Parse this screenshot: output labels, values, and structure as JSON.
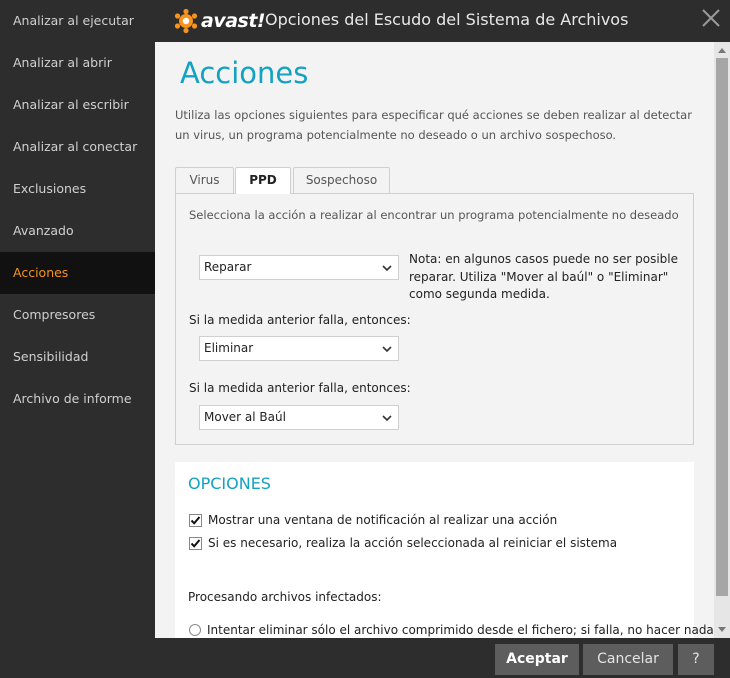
{
  "window": {
    "brand": "avast!",
    "title": "Opciones del Escudo del Sistema de Archivos",
    "close_icon": "close-icon"
  },
  "sidebar": {
    "items": [
      {
        "label": "Analizar al ejecutar"
      },
      {
        "label": "Analizar al abrir"
      },
      {
        "label": "Analizar al escribir"
      },
      {
        "label": "Analizar al conectar"
      },
      {
        "label": "Exclusiones"
      },
      {
        "label": "Avanzado"
      },
      {
        "label": "Acciones",
        "active": true
      },
      {
        "label": "Compresores"
      },
      {
        "label": "Sensibilidad"
      },
      {
        "label": "Archivo de informe"
      }
    ],
    "active_color": "#f7931e"
  },
  "main": {
    "title": "Acciones",
    "intro": "Utiliza las opciones siguientes para especificar qué acciones se deben realizar al detectar un virus, un programa potencialmente no deseado o un archivo sospechoso.",
    "tabs": [
      {
        "label": "Virus"
      },
      {
        "label": "PPD",
        "active": true
      },
      {
        "label": "Sospechoso"
      }
    ],
    "panel": {
      "description": "Selecciona la acción a realizar al encontrar un programa potencialmente no deseado",
      "primary_action": "Reparar",
      "note": "Nota: en algunos casos puede no ser posible reparar. Utiliza \"Mover al baúl\" o \"Eliminar\" como segunda medida.",
      "fallback_label_1": "Si la medida anterior falla, entonces:",
      "fallback_action_1": "Eliminar",
      "fallback_label_2": "Si la medida anterior falla, entonces:",
      "fallback_action_2": "Mover al Baúl"
    },
    "options": {
      "title": "OPCIONES",
      "show_notification": {
        "label": "Mostrar una ventana de notificación al realizar una acción",
        "checked": true
      },
      "perform_on_reboot": {
        "label": "Si es necesario, realiza la acción seleccionada al reiniciar el sistema",
        "checked": true
      },
      "processing_label": "Procesando archivos infectados:",
      "radio_option_1": {
        "label": "Intentar eliminar sólo el archivo comprimido desde el fichero; si falla, no hacer nada",
        "selected": false
      }
    }
  },
  "footer": {
    "accept": "Aceptar",
    "cancel": "Cancelar",
    "help": "?"
  },
  "colors": {
    "accent": "#13a2c2",
    "sidebar_bg": "#2d2d2d",
    "active_item_bg": "#111111",
    "brand_orange": "#f7931e"
  }
}
